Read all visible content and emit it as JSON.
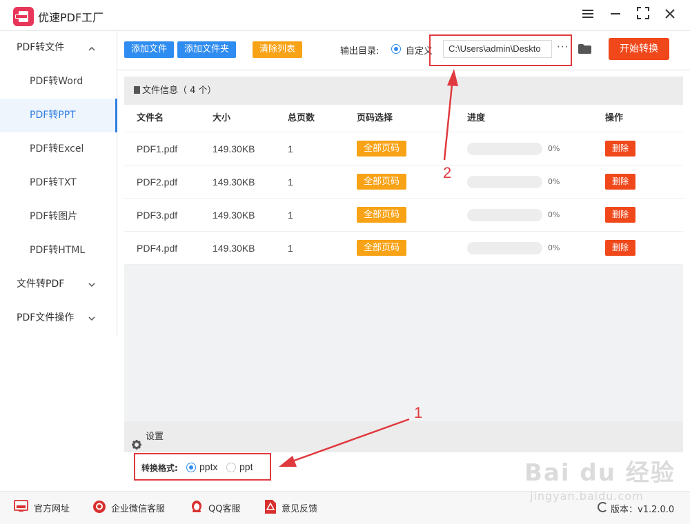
{
  "app": {
    "title": "优速PDF工厂"
  },
  "sidebar": {
    "groups": [
      {
        "label": "PDF转文件",
        "chevron": "chevron-up-icon"
      },
      {
        "label": "文件转PDF",
        "chevron": "chevron-down-icon"
      },
      {
        "label": "PDF文件操作",
        "chevron": "chevron-down-icon"
      }
    ],
    "items": [
      {
        "label": "PDF转Word",
        "active": false
      },
      {
        "label": "PDF转PPT",
        "active": true
      },
      {
        "label": "PDF转Excel",
        "active": false
      },
      {
        "label": "PDF转TXT",
        "active": false
      },
      {
        "label": "PDF转图片",
        "active": false
      },
      {
        "label": "PDF转HTML",
        "active": false
      }
    ]
  },
  "toolbar": {
    "add_file": "添加文件",
    "add_folder": "添加文件夹",
    "clear_list": "清除列表",
    "output_dir_label": "输出目录:",
    "custom_label": "自定义",
    "output_path": "C:\\Users\\admin\\Deskto",
    "more": "···",
    "start": "开始转换"
  },
  "file_panel": {
    "title": "文件信息（ 4 个）",
    "columns": [
      "文件名",
      "大小",
      "总页数",
      "页码选择",
      "进度",
      "操作"
    ],
    "rows": [
      {
        "name": "PDF1.pdf",
        "size": "149.30KB",
        "pages": "1",
        "page_select": "全部页码",
        "progress": 0,
        "progress_text": "0%",
        "action": "删除"
      },
      {
        "name": "PDF2.pdf",
        "size": "149.30KB",
        "pages": "1",
        "page_select": "全部页码",
        "progress": 0,
        "progress_text": "0%",
        "action": "删除"
      },
      {
        "name": "PDF3.pdf",
        "size": "149.30KB",
        "pages": "1",
        "page_select": "全部页码",
        "progress": 0,
        "progress_text": "0%",
        "action": "删除"
      },
      {
        "name": "PDF4.pdf",
        "size": "149.30KB",
        "pages": "1",
        "page_select": "全部页码",
        "progress": 0,
        "progress_text": "0%",
        "action": "删除"
      }
    ]
  },
  "settings": {
    "title": "设置",
    "format_label": "转换格式:",
    "options": [
      {
        "label": "pptx",
        "selected": true
      },
      {
        "label": "ppt",
        "selected": false
      }
    ]
  },
  "annotations": {
    "num1": "1",
    "num2": "2"
  },
  "footer": {
    "website": "官方网址",
    "wechat": "企业微信客服",
    "qq": "QQ客服",
    "feedback": "意见反馈",
    "version": "版本：v1.2.0.0"
  },
  "watermark": {
    "brand": "Bai du 经验",
    "url": "jingyan.baidu.com"
  },
  "colors": {
    "accent": "#2f8cf0",
    "orange": "#f8a215",
    "red": "#f0481b",
    "annotation": "#e0393e",
    "active_text": "#2f7fe0"
  }
}
